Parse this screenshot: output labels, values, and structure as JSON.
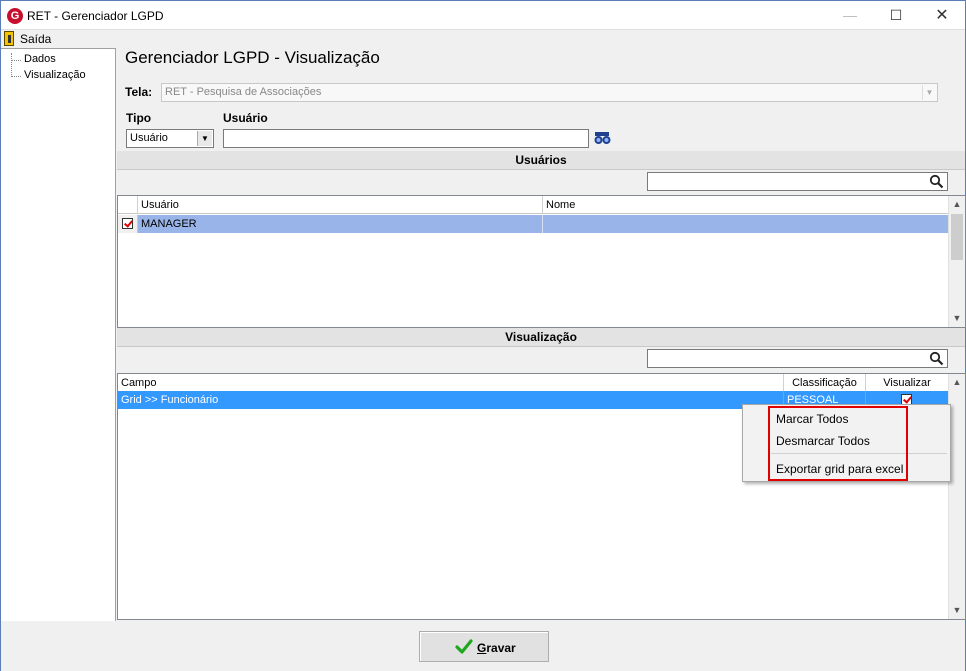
{
  "window": {
    "title": "RET - Gerenciador LGPD",
    "minimize_glyph": "—",
    "maximize_glyph": "☐",
    "close_glyph": "✕",
    "app_icon_letter": "G"
  },
  "menu": {
    "exit_label": "Saída"
  },
  "tree": {
    "items": [
      {
        "label": "Dados"
      },
      {
        "label": "Visualização"
      }
    ]
  },
  "page": {
    "title": "Gerenciador LGPD - Visualização"
  },
  "form": {
    "tela_label": "Tela:",
    "tela_value": "RET - Pesquisa de Associações",
    "tipo_label": "Tipo",
    "tipo_value": "Usuário",
    "usuario_label": "Usuário",
    "usuario_value": ""
  },
  "users_section": {
    "header": "Usuários",
    "search_value": "",
    "columns": [
      "Usuário",
      "Nome"
    ],
    "rows": [
      {
        "checked": true,
        "usuario": "MANAGER",
        "nome": ""
      }
    ]
  },
  "view_section": {
    "header": "Visualização",
    "search_value": "",
    "columns": [
      "Campo",
      "Classificação",
      "Visualizar"
    ],
    "rows": [
      {
        "campo": "Grid >> Funcionário",
        "classificacao": "PESSOAL",
        "visualizar": true
      }
    ]
  },
  "context_menu": {
    "items": [
      "Marcar Todos",
      "Desmarcar Todos",
      "Exportar grid para excel"
    ]
  },
  "footer": {
    "save_label": "Gravar"
  },
  "colors": {
    "selected_row_user": "#99b4e8",
    "selected_row_view": "#3399ff",
    "highlight": "#e00000",
    "app_icon": "#c8102e"
  },
  "icons": {
    "app": "app-logo-icon",
    "exit": "exit-door-icon",
    "find": "binoculars-icon",
    "search": "magnifier-icon",
    "save": "green-check-icon"
  }
}
